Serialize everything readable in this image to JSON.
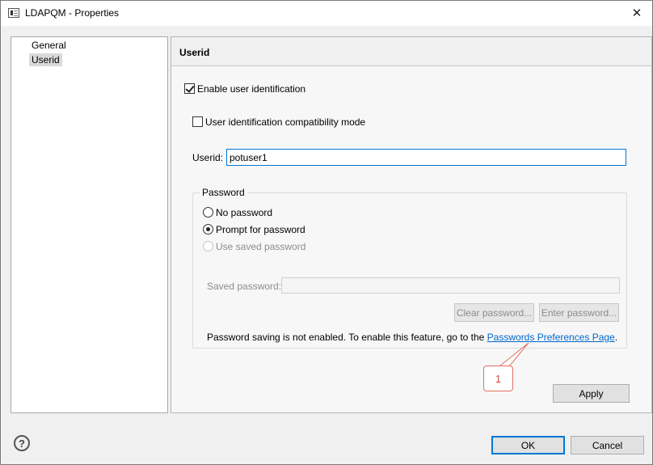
{
  "window": {
    "title": "LDAPQM - Properties"
  },
  "nav": {
    "items": [
      {
        "label": "General"
      },
      {
        "label": "Userid"
      }
    ]
  },
  "panel": {
    "title": "Userid",
    "enable_user_identification": {
      "label": "Enable user identification",
      "checked": true
    },
    "compat_mode": {
      "label": "User identification compatibility mode",
      "checked": false
    },
    "userid": {
      "label": "Userid:",
      "value": "potuser1"
    },
    "password": {
      "legend": "Password",
      "options": [
        {
          "label": "No password",
          "selected": false,
          "enabled": true
        },
        {
          "label": "Prompt for password",
          "selected": true,
          "enabled": true
        },
        {
          "label": "Use saved password",
          "selected": false,
          "enabled": false
        }
      ],
      "saved_password_label": "Saved password:",
      "saved_password_value": "",
      "clear_button": "Clear password...",
      "enter_button": "Enter password...",
      "info_text": "Password saving is not enabled.  To enable this feature, go to the ",
      "link_text": "Passwords Preferences Page",
      "info_suffix": "."
    },
    "apply_button": "Apply"
  },
  "callout": {
    "number": "1",
    "color": "#e07060"
  },
  "footer": {
    "ok_button": "OK",
    "cancel_button": "Cancel",
    "help_icon": "?"
  }
}
